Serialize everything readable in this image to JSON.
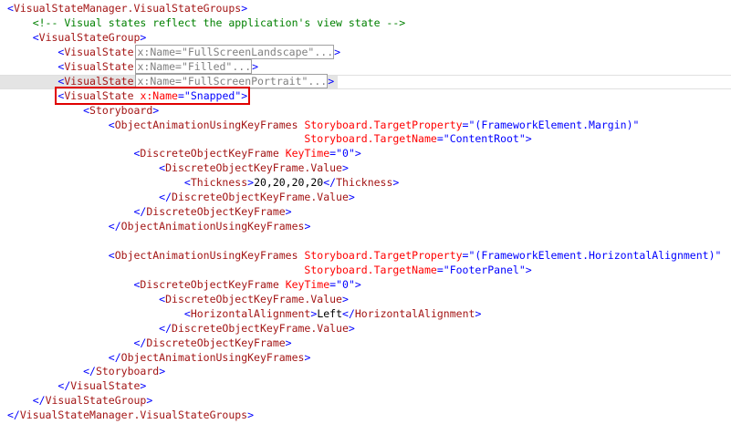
{
  "editor": {
    "highlighted_line": 6,
    "current_line": 5,
    "lines": [
      [
        [
          "b",
          "<"
        ],
        [
          "e",
          "VisualStateManager.VisualStateGroups"
        ],
        [
          "b",
          ">"
        ]
      ],
      [
        [
          "t",
          "    "
        ],
        [
          "c",
          "<!-- Visual states reflect the application's view state -->"
        ]
      ],
      [
        [
          "t",
          "    "
        ],
        [
          "b",
          "<"
        ],
        [
          "e",
          "VisualStateGroup"
        ],
        [
          "b",
          ">"
        ]
      ],
      [
        [
          "t",
          "        "
        ],
        [
          "b",
          "<"
        ],
        [
          "e",
          "VisualState"
        ],
        [
          "x",
          "x:Name=\"FullScreenLandscape\"..."
        ],
        [
          "b",
          ">"
        ]
      ],
      [
        [
          "t",
          "        "
        ],
        [
          "b",
          "<"
        ],
        [
          "e",
          "VisualState"
        ],
        [
          "x",
          "x:Name=\"Filled\"..."
        ],
        [
          "b",
          ">"
        ]
      ],
      [
        [
          "t",
          "        "
        ],
        [
          "b",
          "<"
        ],
        [
          "e",
          "VisualState"
        ],
        [
          "x",
          "x:Name=\"FullScreenPortrait\"..."
        ],
        [
          "b",
          ">"
        ]
      ],
      [
        [
          "t",
          "        "
        ],
        [
          "b",
          "<"
        ],
        [
          "e",
          "VisualState"
        ],
        [
          "t",
          " "
        ],
        [
          "a",
          "x:Name"
        ],
        [
          "b",
          "=\""
        ],
        [
          "v",
          "Snapped"
        ],
        [
          "b",
          "\">"
        ]
      ],
      [
        [
          "t",
          "            "
        ],
        [
          "b",
          "<"
        ],
        [
          "e",
          "Storyboard"
        ],
        [
          "b",
          ">"
        ]
      ],
      [
        [
          "t",
          "                "
        ],
        [
          "b",
          "<"
        ],
        [
          "e",
          "ObjectAnimationUsingKeyFrames"
        ],
        [
          "t",
          " "
        ],
        [
          "a",
          "Storyboard.TargetProperty"
        ],
        [
          "b",
          "=\""
        ],
        [
          "v",
          "(FrameworkElement.Margin)"
        ],
        [
          "b",
          "\""
        ]
      ],
      [
        [
          "t",
          "                                               "
        ],
        [
          "a",
          "Storyboard.TargetName"
        ],
        [
          "b",
          "=\""
        ],
        [
          "v",
          "ContentRoot"
        ],
        [
          "b",
          "\">"
        ]
      ],
      [
        [
          "t",
          "                    "
        ],
        [
          "b",
          "<"
        ],
        [
          "e",
          "DiscreteObjectKeyFrame"
        ],
        [
          "t",
          " "
        ],
        [
          "a",
          "KeyTime"
        ],
        [
          "b",
          "=\""
        ],
        [
          "v",
          "0"
        ],
        [
          "b",
          "\">"
        ]
      ],
      [
        [
          "t",
          "                        "
        ],
        [
          "b",
          "<"
        ],
        [
          "e",
          "DiscreteObjectKeyFrame.Value"
        ],
        [
          "b",
          ">"
        ]
      ],
      [
        [
          "t",
          "                            "
        ],
        [
          "b",
          "<"
        ],
        [
          "e",
          "Thickness"
        ],
        [
          "b",
          ">"
        ],
        [
          "t",
          "20,20,20,20"
        ],
        [
          "b",
          "</"
        ],
        [
          "e",
          "Thickness"
        ],
        [
          "b",
          ">"
        ]
      ],
      [
        [
          "t",
          "                        "
        ],
        [
          "b",
          "</"
        ],
        [
          "e",
          "DiscreteObjectKeyFrame.Value"
        ],
        [
          "b",
          ">"
        ]
      ],
      [
        [
          "t",
          "                    "
        ],
        [
          "b",
          "</"
        ],
        [
          "e",
          "DiscreteObjectKeyFrame"
        ],
        [
          "b",
          ">"
        ]
      ],
      [
        [
          "t",
          "                "
        ],
        [
          "b",
          "</"
        ],
        [
          "e",
          "ObjectAnimationUsingKeyFrames"
        ],
        [
          "b",
          ">"
        ]
      ],
      [],
      [
        [
          "t",
          "                "
        ],
        [
          "b",
          "<"
        ],
        [
          "e",
          "ObjectAnimationUsingKeyFrames"
        ],
        [
          "t",
          " "
        ],
        [
          "a",
          "Storyboard.TargetProperty"
        ],
        [
          "b",
          "=\""
        ],
        [
          "v",
          "(FrameworkElement.HorizontalAlignment)"
        ],
        [
          "b",
          "\""
        ]
      ],
      [
        [
          "t",
          "                                               "
        ],
        [
          "a",
          "Storyboard.TargetName"
        ],
        [
          "b",
          "=\""
        ],
        [
          "v",
          "FooterPanel"
        ],
        [
          "b",
          "\">"
        ]
      ],
      [
        [
          "t",
          "                    "
        ],
        [
          "b",
          "<"
        ],
        [
          "e",
          "DiscreteObjectKeyFrame"
        ],
        [
          "t",
          " "
        ],
        [
          "a",
          "KeyTime"
        ],
        [
          "b",
          "=\""
        ],
        [
          "v",
          "0"
        ],
        [
          "b",
          "\">"
        ]
      ],
      [
        [
          "t",
          "                        "
        ],
        [
          "b",
          "<"
        ],
        [
          "e",
          "DiscreteObjectKeyFrame.Value"
        ],
        [
          "b",
          ">"
        ]
      ],
      [
        [
          "t",
          "                            "
        ],
        [
          "b",
          "<"
        ],
        [
          "e",
          "HorizontalAlignment"
        ],
        [
          "b",
          ">"
        ],
        [
          "t",
          "Left"
        ],
        [
          "b",
          "</"
        ],
        [
          "e",
          "HorizontalAlignment"
        ],
        [
          "b",
          ">"
        ]
      ],
      [
        [
          "t",
          "                        "
        ],
        [
          "b",
          "</"
        ],
        [
          "e",
          "DiscreteObjectKeyFrame.Value"
        ],
        [
          "b",
          ">"
        ]
      ],
      [
        [
          "t",
          "                    "
        ],
        [
          "b",
          "</"
        ],
        [
          "e",
          "DiscreteObjectKeyFrame"
        ],
        [
          "b",
          ">"
        ]
      ],
      [
        [
          "t",
          "                "
        ],
        [
          "b",
          "</"
        ],
        [
          "e",
          "ObjectAnimationUsingKeyFrames"
        ],
        [
          "b",
          ">"
        ]
      ],
      [
        [
          "t",
          "            "
        ],
        [
          "b",
          "</"
        ],
        [
          "e",
          "Storyboard"
        ],
        [
          "b",
          ">"
        ]
      ],
      [
        [
          "t",
          "        "
        ],
        [
          "b",
          "</"
        ],
        [
          "e",
          "VisualState"
        ],
        [
          "b",
          ">"
        ]
      ],
      [
        [
          "t",
          "    "
        ],
        [
          "b",
          "</"
        ],
        [
          "e",
          "VisualStateGroup"
        ],
        [
          "b",
          ">"
        ]
      ],
      [
        [
          "b",
          "</"
        ],
        [
          "e",
          "VisualStateManager.VisualStateGroups"
        ],
        [
          "b",
          ">"
        ]
      ]
    ]
  }
}
